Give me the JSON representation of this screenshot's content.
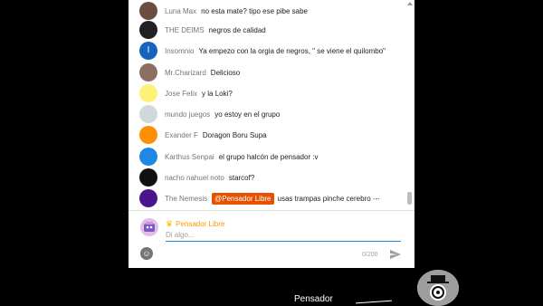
{
  "chat": {
    "messages": [
      {
        "author": "Luna Max",
        "text": "no esta mate? tipo ese pibe sabe",
        "avatar_color": "#6d4c41",
        "avatar_icon": "cat-face-avatar"
      },
      {
        "author": "THE DEIMS",
        "text": "negros de calidad",
        "avatar_color": "#222222",
        "avatar_icon": "dark-mask-avatar"
      },
      {
        "author": "Insomnio",
        "text": "Ya empezo con la orgia de negros, \" se viene el quilombo\"",
        "avatar_color": "#1565c0",
        "avatar_icon": "letter-avatar",
        "avatar_letter": "I"
      },
      {
        "author": "Mr.Charizard",
        "text": "Delicioso",
        "avatar_color": "#8d6e63",
        "avatar_icon": "cartoon-face-avatar"
      },
      {
        "author": "Jose Felix",
        "text": "y la Loki?",
        "avatar_color": "#fff176",
        "avatar_icon": "pikachu-avatar"
      },
      {
        "author": "mundo juegos",
        "text": "yo estoy en el grupo",
        "avatar_color": "#cfd8dc",
        "avatar_icon": "robot-avatar"
      },
      {
        "author": "Exander F",
        "text": "Doragon Boru Supa",
        "avatar_color": "#ff8f00",
        "avatar_icon": "dragon-ball-avatar"
      },
      {
        "author": "Karthus Senpai",
        "text": "el grupo halcón de pensador :v",
        "avatar_color": "#1e88e5",
        "avatar_icon": "globe-avatar"
      },
      {
        "author": "nacho nahuel noto",
        "text": "starcof?",
        "avatar_color": "#111111",
        "avatar_icon": "skull-avatar"
      },
      {
        "author": "The Nemesis",
        "mention": "@Pensador Libre",
        "text": "usas trampas pinche cerebro ·-·",
        "avatar_color": "#4a148c",
        "avatar_icon": "galaxy-avatar"
      }
    ]
  },
  "composer": {
    "user_name": "Pensador Libre",
    "placeholder": "Di algo...",
    "counter": "0/200",
    "accent": "#ff9800",
    "input_accent": "#1e88e5"
  },
  "stream": {
    "streamer_label": "Pensador"
  }
}
